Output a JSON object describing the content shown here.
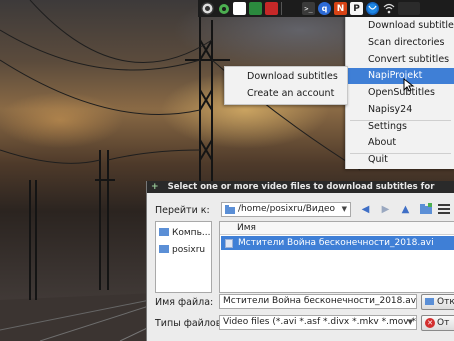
{
  "tray": {
    "icons": [
      "obs-icon",
      "gear-icon",
      "color-square-icon",
      "monitor-icon",
      "terminal-icon",
      "qbittorrent-icon",
      "napi-icon",
      "p-icon",
      "firefox-icon",
      "wifi-icon",
      "blank-icon"
    ],
    "terminal_glyph": ">_",
    "napi_glyph": "N",
    "p_glyph": "P"
  },
  "menu": {
    "items": [
      {
        "label": "Download subtitles"
      },
      {
        "label": "Scan directories"
      },
      {
        "label": "Convert subtitles"
      },
      {
        "label": "NapiProjekt"
      },
      {
        "label": "OpenSubtitles"
      },
      {
        "label": "Napisy24"
      },
      {
        "label": "Settings"
      },
      {
        "label": "About"
      },
      {
        "label": "Quit"
      }
    ],
    "active_index": 3,
    "active_color": "#3f7fd6"
  },
  "submenu": {
    "items": [
      {
        "label": "Download subtitles"
      },
      {
        "label": "Create an account"
      }
    ]
  },
  "dialog": {
    "title": "Select one or more video files to download subtitles for",
    "look_in_label": "Перейти к:",
    "look_in_path": "/home/posixru/Видео",
    "places": [
      {
        "label": "Компь..."
      },
      {
        "label": "posixru"
      }
    ],
    "columns": {
      "name": "Имя"
    },
    "files": [
      {
        "name": "Мстители Война бесконечности_2018.avi"
      }
    ],
    "filename_label": "Имя файла:",
    "filename_value": "Мстители Война бесконечности_2018.avi",
    "filetype_label": "Типы файлов:",
    "filetype_value": "Video files (*.avi *.asf *.divx *.mkv *.mov *.mp",
    "open_button": "Откр",
    "cancel_button": "От"
  }
}
